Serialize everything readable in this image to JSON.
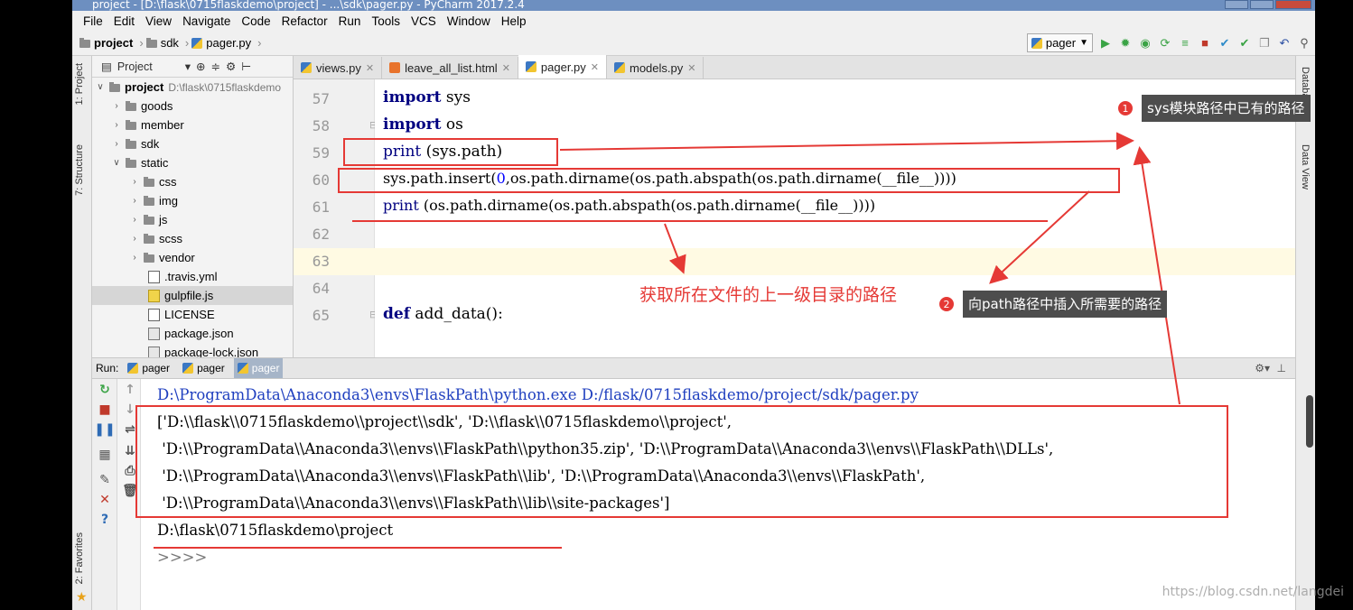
{
  "window": {
    "title": "project - [D:\\flask\\0715flaskdemo\\project] - ...\\sdk\\pager.py - PyCharm 2017.2.4"
  },
  "menu": [
    "File",
    "Edit",
    "View",
    "Navigate",
    "Code",
    "Refactor",
    "Run",
    "Tools",
    "VCS",
    "Window",
    "Help"
  ],
  "breadcrumb": {
    "items": [
      "project",
      "sdk",
      "pager.py"
    ]
  },
  "run_config": {
    "label": "pager"
  },
  "side_tabs": {
    "project": "1: Project",
    "structure": "7: Structure",
    "favorites": "2: Favorites",
    "database": "Database",
    "dataview": "Data View"
  },
  "project_panel": {
    "header": "Project",
    "root": {
      "name": "project",
      "path": "D:\\flask\\0715flaskdemo"
    },
    "items": [
      {
        "label": "goods"
      },
      {
        "label": "member"
      },
      {
        "label": "sdk"
      },
      {
        "label": "static"
      },
      {
        "label": "css"
      },
      {
        "label": "img"
      },
      {
        "label": "js"
      },
      {
        "label": "scss"
      },
      {
        "label": "vendor"
      },
      {
        "label": ".travis.yml"
      },
      {
        "label": "gulpfile.js"
      },
      {
        "label": "LICENSE"
      },
      {
        "label": "package.json"
      },
      {
        "label": "package-lock.json"
      }
    ]
  },
  "editor_tabs": [
    {
      "label": "views.py"
    },
    {
      "label": "leave_all_list.html"
    },
    {
      "label": "pager.py"
    },
    {
      "label": "models.py"
    }
  ],
  "code": {
    "lines": [
      {
        "no": "57"
      },
      {
        "no": "58"
      },
      {
        "no": "59"
      },
      {
        "no": "60"
      },
      {
        "no": "61"
      },
      {
        "no": "62"
      },
      {
        "no": "63"
      },
      {
        "no": "64"
      },
      {
        "no": "65"
      }
    ],
    "l57a": "import",
    "l57b": " sys",
    "l58a": "import",
    "l58b": " os",
    "l59a": "print",
    "l59b": " (sys.path)",
    "l60a": "sys.path.insert(",
    "l60b": "0",
    "l60c": ",os.path.dirname(os.path.abspath(os.path.dirname(__file__))))",
    "l61a": "print",
    "l61b": " (os.path.dirname(os.path.abspath(os.path.dirname(__file__))))",
    "l65a": "def",
    "l65b": " add_data():"
  },
  "run_panel": {
    "label": "Run:",
    "tabs": [
      {
        "label": "pager"
      },
      {
        "label": "pager"
      },
      {
        "label": "pager"
      }
    ]
  },
  "console": {
    "lines": [
      "D:\\ProgramData\\Anaconda3\\envs\\FlaskPath\\python.exe D:/flask/0715flaskdemo/project/sdk/pager.py",
      "['D:\\\\flask\\\\0715flaskdemo\\\\project\\\\sdk', 'D:\\\\flask\\\\0715flaskdemo\\\\project',",
      " 'D:\\\\ProgramData\\\\Anaconda3\\\\envs\\\\FlaskPath\\\\python35.zip', 'D:\\\\ProgramData\\\\Anaconda3\\\\envs\\\\FlaskPath\\\\DLLs',",
      " 'D:\\\\ProgramData\\\\Anaconda3\\\\envs\\\\FlaskPath\\\\lib', 'D:\\\\ProgramData\\\\Anaconda3\\\\envs\\\\FlaskPath',",
      " 'D:\\\\ProgramData\\\\Anaconda3\\\\envs\\\\FlaskPath\\\\lib\\\\site-packages']",
      "D:\\flask\\0715flaskdemo\\project",
      ">>>>"
    ]
  },
  "annotations": {
    "callout1": {
      "badge": "1",
      "text": "sys模块路径中已有的路径"
    },
    "callout2": {
      "badge": "2",
      "text": "向path路径中插入所需要的路径"
    },
    "middle_text": "获取所在文件的上一级目录的路径",
    "color": "#e53935"
  },
  "watermark": "https://blog.csdn.net/langdei"
}
